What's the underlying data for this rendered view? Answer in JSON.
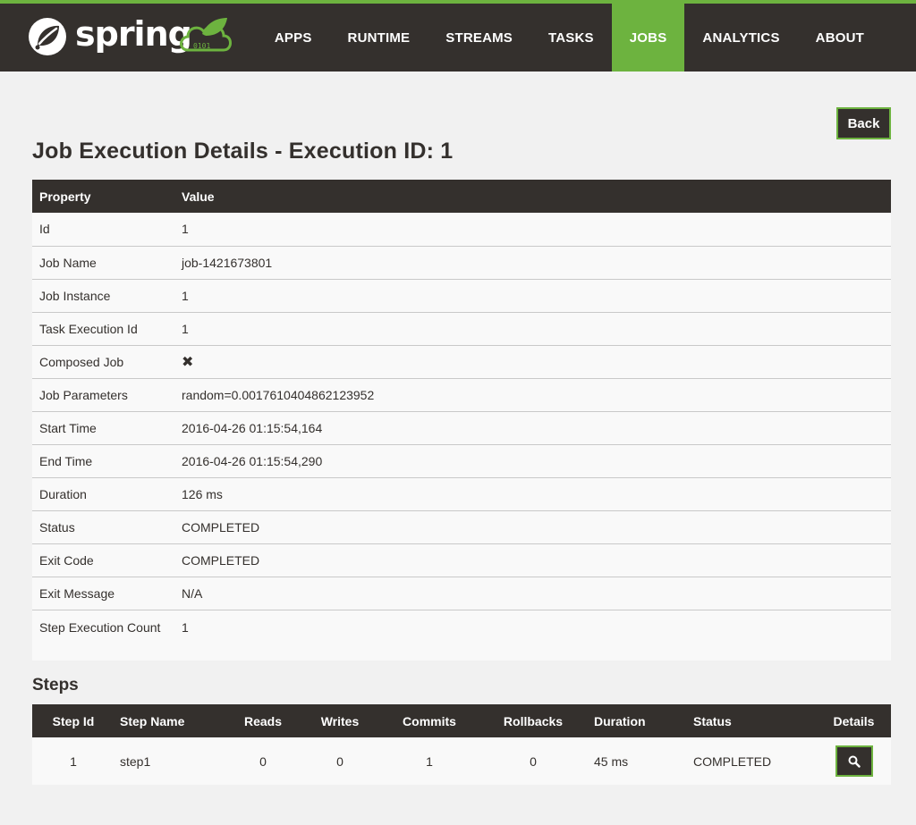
{
  "brand": {
    "name": "spring",
    "accent": "#6db33f",
    "dark": "#34302d",
    "logo_icon": "spring-leaf-icon",
    "cloud_icon": "cloud-leaf-icon"
  },
  "nav": {
    "items": [
      "APPS",
      "RUNTIME",
      "STREAMS",
      "TASKS",
      "JOBS",
      "ANALYTICS",
      "ABOUT"
    ],
    "active": "JOBS"
  },
  "back_label": "Back",
  "page_title": "Job Execution Details - Execution ID: 1",
  "details": {
    "headers": [
      "Property",
      "Value"
    ],
    "rows": [
      {
        "property": "Id",
        "value": "1"
      },
      {
        "property": "Job Name",
        "value": "job-1421673801"
      },
      {
        "property": "Job Instance",
        "value": "1"
      },
      {
        "property": "Task Execution Id",
        "value": "1"
      },
      {
        "property": "Composed Job",
        "value": "✖",
        "icon": "cross-icon"
      },
      {
        "property": "Job Parameters",
        "value": "random=0.0017610404862123952"
      },
      {
        "property": "Start Time",
        "value": "2016-04-26 01:15:54,164"
      },
      {
        "property": "End Time",
        "value": "2016-04-26 01:15:54,290"
      },
      {
        "property": "Duration",
        "value": "126 ms"
      },
      {
        "property": "Status",
        "value": "COMPLETED"
      },
      {
        "property": "Exit Code",
        "value": "COMPLETED"
      },
      {
        "property": "Exit Message",
        "value": "N/A"
      },
      {
        "property": "Step Execution Count",
        "value": "1"
      }
    ]
  },
  "steps": {
    "title": "Steps",
    "headers": [
      "Step Id",
      "Step Name",
      "Reads",
      "Writes",
      "Commits",
      "Rollbacks",
      "Duration",
      "Status",
      "Details"
    ],
    "rows": [
      {
        "step_id": "1",
        "step_name": "step1",
        "reads": "0",
        "writes": "0",
        "commits": "1",
        "rollbacks": "0",
        "duration": "45 ms",
        "status": "COMPLETED",
        "details_icon": "search-icon"
      }
    ]
  },
  "status_color": "#3b7a35"
}
